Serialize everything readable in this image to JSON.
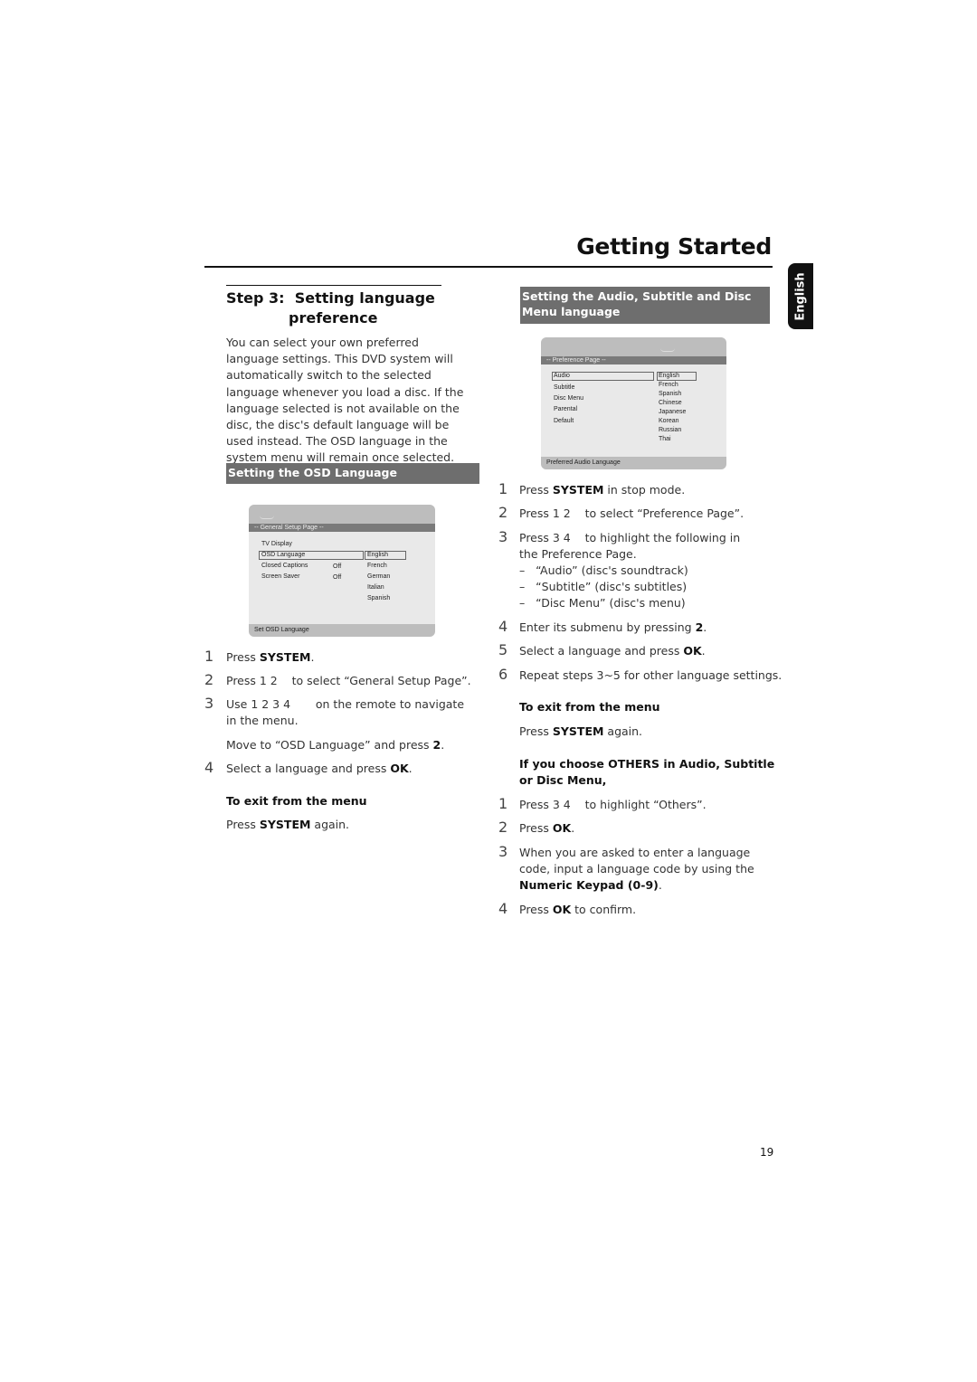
{
  "header": {
    "title": "Getting Started",
    "language_tab": "English"
  },
  "step": {
    "label": "Step 3:",
    "title_line1": "Setting language",
    "title_line2": "preference"
  },
  "intro": "You can select your own preferred language settings. This DVD system will automatically switch to the selected language whenever you load a disc. If the language selected is not available on the disc, the disc's default language will be used instead. The OSD language in the system menu will remain once selected.",
  "osd_section": {
    "heading": "Setting the OSD Language",
    "screen": {
      "page_header": "-- General Setup Page --",
      "items": [
        "TV Display",
        "OSD Language",
        "Closed Captions",
        "Screen Saver"
      ],
      "values": [
        "",
        "",
        "Off",
        "Off"
      ],
      "options": [
        "English",
        "French",
        "German",
        "Italian",
        "Spanish"
      ],
      "footer": "Set OSD Language"
    },
    "steps": [
      {
        "n": "1",
        "pre": "Press ",
        "bold": "SYSTEM",
        "post": "."
      },
      {
        "n": "2",
        "pre": "Press 1 2    to select “General Setup Page”.",
        "bold": "",
        "post": ""
      },
      {
        "n": "3",
        "pre": "Use 1 2 3 4       on the remote to navigate in the menu.",
        "bold": "",
        "post": ""
      },
      {
        "n": "",
        "pre": "Move to “OSD Language” and press ",
        "bold": "2",
        "post": "."
      },
      {
        "n": "4",
        "pre": "Select a language and press ",
        "bold": "OK",
        "post": "."
      }
    ],
    "exit_heading": "To exit from the menu",
    "exit_pre": "Press ",
    "exit_bold": "SYSTEM",
    "exit_post": " again."
  },
  "audio_section": {
    "heading": "Setting the Audio, Subtitle and Disc Menu language",
    "screen": {
      "page_header": "-- Preference Page --",
      "items": [
        "Audio",
        "Subtitle",
        "Disc Menu",
        "Parental",
        "Default"
      ],
      "options": [
        "English",
        "French",
        "Spanish",
        "Chinese",
        "Japanese",
        "Korean",
        "Russian",
        "Thai"
      ],
      "footer": "Preferred Audio Language"
    },
    "steps": [
      {
        "n": "1",
        "pre": "Press ",
        "bold": "SYSTEM",
        "post": " in stop mode."
      },
      {
        "n": "2",
        "pre": "Press 1 2    to select “Preference Page”.",
        "bold": "",
        "post": ""
      },
      {
        "n": "3",
        "pre": "Press 3 4    to highlight the following in the Preference Page.",
        "bold": "",
        "post": ""
      },
      {
        "n": "4",
        "pre": "Enter its submenu by pressing ",
        "bold": "2",
        "post": "."
      },
      {
        "n": "5",
        "pre": "Select a language and press ",
        "bold": "OK",
        "post": "."
      },
      {
        "n": "6",
        "pre": "Repeat steps 3~5 for other language settings.",
        "bold": "",
        "post": ""
      }
    ],
    "dash_items": [
      "“Audio” (disc's soundtrack)",
      "“Subtitle” (disc's subtitles)",
      "“Disc Menu” (disc's menu)"
    ],
    "exit_heading": "To exit from the menu",
    "exit_pre": "Press ",
    "exit_bold": "SYSTEM",
    "exit_post": " again.",
    "others_heading": "If you choose OTHERS in Audio, Subtitle or Disc Menu,",
    "others_steps": [
      {
        "n": "1",
        "pre": "Press 3 4    to highlight “Others”.",
        "bold": "",
        "post": ""
      },
      {
        "n": "2",
        "pre": "Press ",
        "bold": "OK",
        "post": "."
      },
      {
        "n": "3",
        "pre": "When you are asked to enter a language code, input a language code by using the ",
        "bold": "Numeric Keypad (0-9)",
        "post": "."
      },
      {
        "n": "4",
        "pre": "Press ",
        "bold": "OK",
        "post": " to confirm."
      }
    ]
  },
  "page_number": "19"
}
